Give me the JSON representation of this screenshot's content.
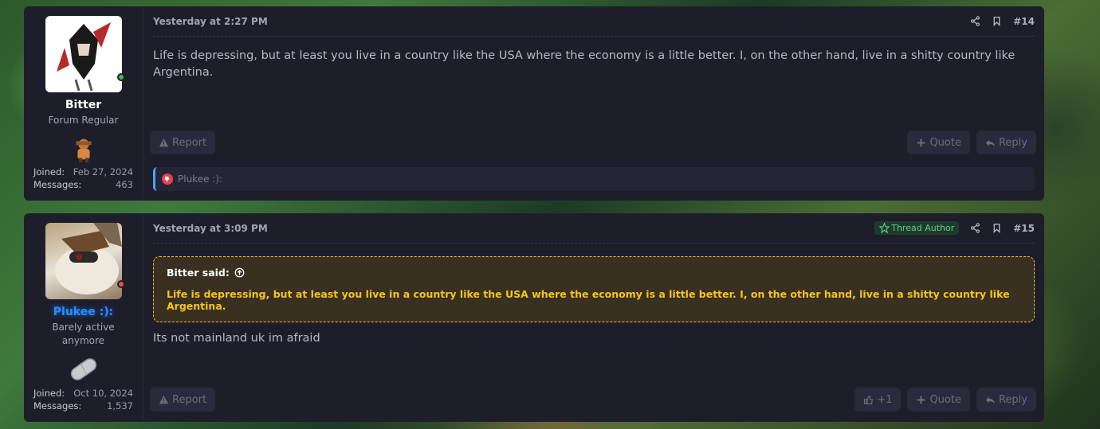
{
  "posts": [
    {
      "user": {
        "name": "Bitter",
        "title": "Forum Regular",
        "joined_label": "Joined:",
        "joined_value": "Feb 27, 2024",
        "messages_label": "Messages:",
        "messages_value": "463"
      },
      "date": "Yesterday at 2:27 PM",
      "number": "#14",
      "body": "Life is depressing, but at least you live in a country like the USA where the economy is a little better. I, on the other hand, live in a shitty country like Argentina.",
      "actions": {
        "report": "Report",
        "quote": "Quote",
        "reply": "Reply"
      },
      "reaction_by": "Plukee :):"
    },
    {
      "user": {
        "name": "Plukee :):",
        "title": "Barely active anymore",
        "joined_label": "Joined:",
        "joined_value": "Oct 10, 2024",
        "messages_label": "Messages:",
        "messages_value": "1,537"
      },
      "date": "Yesterday at 3:09 PM",
      "badge": "Thread Author",
      "number": "#15",
      "quote": {
        "attribution": "Bitter said:",
        "text": "Life is depressing, but at least you live in a country like the USA where the economy is a little better. I, on the other hand, live in a shitty country like Argentina."
      },
      "body": "Its not mainland uk im afraid",
      "actions": {
        "report": "Report",
        "like": "+1",
        "quote": "Quote",
        "reply": "Reply"
      }
    }
  ],
  "colors": {
    "accent_quote": "#f5c518",
    "thread_author": "#55d38a",
    "username_blue": "#2a8cff"
  }
}
